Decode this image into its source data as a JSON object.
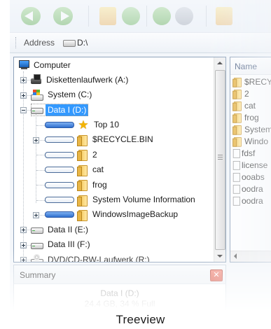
{
  "toolbar": {
    "buttons": [
      "back-icon",
      "forward-icon",
      "up-folder-icon",
      "refresh-icon",
      "go-icon",
      "home-icon",
      "folders-icon"
    ]
  },
  "address": {
    "label": "Address",
    "value": "D:\\"
  },
  "tree": {
    "root": "Computer",
    "drives": [
      {
        "label": "Diskettenlaufwerk (A:)",
        "icon": "floppy-drive-icon",
        "expander": "plus"
      },
      {
        "label": "System (C:)",
        "icon": "windows-drive-icon",
        "expander": "plus"
      },
      {
        "label": "Data I (D:)",
        "icon": "hard-drive-icon",
        "expander": "minus",
        "selected": true
      },
      {
        "label": "Data II (E:)",
        "icon": "hard-drive-icon",
        "expander": "plus"
      },
      {
        "label": "Data III (F:)",
        "icon": "hard-drive-icon",
        "expander": "plus"
      },
      {
        "label": "DVD/CD-RW-Laufwerk (R:)",
        "icon": "dvd-drive-icon",
        "expander": "plus"
      }
    ],
    "children_of_d": [
      {
        "label": "Top 10",
        "icon": "star-icon",
        "size_bar": "full"
      },
      {
        "label": "$RECYCLE.BIN",
        "icon": "folder-icon",
        "size_bar": "empty",
        "expander": "plus"
      },
      {
        "label": "2",
        "icon": "folder-icon",
        "size_bar": "empty"
      },
      {
        "label": "cat",
        "icon": "folder-icon",
        "size_bar": "empty"
      },
      {
        "label": "frog",
        "icon": "folder-icon",
        "size_bar": "empty"
      },
      {
        "label": "System Volume Information",
        "icon": "folder-icon",
        "size_bar": "empty"
      },
      {
        "label": "WindowsImageBackup",
        "icon": "folder-icon",
        "size_bar": "full",
        "expander": "plus"
      }
    ]
  },
  "list": {
    "column_name": "Name",
    "items": [
      {
        "label": "$RECYC",
        "icon": "folder-icon"
      },
      {
        "label": "2",
        "icon": "folder-icon"
      },
      {
        "label": "cat",
        "icon": "folder-icon"
      },
      {
        "label": "frog",
        "icon": "folder-icon"
      },
      {
        "label": "System",
        "icon": "folder-icon"
      },
      {
        "label": "Windo",
        "icon": "folder-icon"
      },
      {
        "label": "fdsf",
        "icon": "file-icon"
      },
      {
        "label": "license",
        "icon": "file-icon"
      },
      {
        "label": "ooabs",
        "icon": "file-icon"
      },
      {
        "label": "oodra",
        "icon": "file-icon"
      },
      {
        "label": "oodra",
        "icon": "file-icon"
      }
    ]
  },
  "summary": {
    "title": "Summary",
    "close_glyph": "✕",
    "drive": "Data I (D:)",
    "usage": "24.4 GB, 34 % Full"
  },
  "caption": "Treeview",
  "colors": {
    "selection": "#3399ff",
    "size_bar_full": "#2f6fcf",
    "close_button": "#d8412f"
  }
}
